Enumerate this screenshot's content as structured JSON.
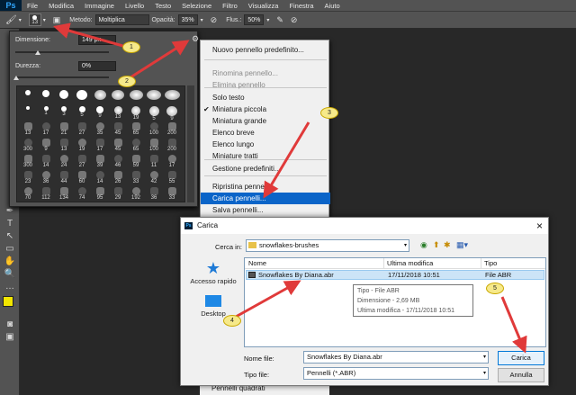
{
  "menubar": {
    "logo": "Ps",
    "items": [
      "File",
      "Modifica",
      "Immagine",
      "Livello",
      "Testo",
      "Selezione",
      "Filtro",
      "Visualizza",
      "Finestra",
      "Aiuto"
    ]
  },
  "options": {
    "brush_size": "13",
    "mode_label": "Metodo:",
    "mode_value": "Moltiplica",
    "opacity_label": "Opacità:",
    "opacity_value": "35%",
    "flow_label": "Flus.:",
    "flow_value": "50%"
  },
  "brush_panel": {
    "size_label": "Dimensione:",
    "size_value": "149 px",
    "hardness_label": "Durezza:",
    "hardness_value": "0%",
    "brush_numbers": [
      "",
      "",
      "",
      "",
      "",
      "",
      "",
      "",
      "",
      "",
      "1",
      "3",
      "5",
      "9",
      "13",
      "19",
      "5",
      "9",
      "13",
      "17",
      "21",
      "27",
      "35",
      "45",
      "65",
      "100",
      "200",
      "300",
      "9",
      "13",
      "19",
      "17",
      "45",
      "65",
      "100",
      "200",
      "300",
      "14",
      "24",
      "27",
      "39",
      "46",
      "59",
      "11",
      "17",
      "23",
      "36",
      "44",
      "60",
      "14",
      "26",
      "33",
      "42",
      "55",
      "70",
      "112",
      "134",
      "74",
      "95",
      "29",
      "192",
      "36",
      "33",
      "63",
      "66"
    ]
  },
  "context_menu": {
    "items": [
      {
        "label": "Nuovo pennello predefinito...",
        "state": "normal"
      },
      {
        "label": "Rinomina pennello...",
        "state": "disabled"
      },
      {
        "label": "Elimina pennello",
        "state": "disabled"
      },
      {
        "label": "Solo testo",
        "state": "normal"
      },
      {
        "label": "Miniatura piccola",
        "state": "checked"
      },
      {
        "label": "Miniatura grande",
        "state": "normal"
      },
      {
        "label": "Elenco breve",
        "state": "normal"
      },
      {
        "label": "Elenco lungo",
        "state": "normal"
      },
      {
        "label": "Miniature tratti",
        "state": "normal"
      },
      {
        "label": "Gestione predefiniti...",
        "state": "normal"
      },
      {
        "label": "Ripristina pennelli...",
        "state": "normal"
      },
      {
        "label": "Carica pennelli...",
        "state": "selected"
      },
      {
        "label": "Salva pennelli...",
        "state": "normal"
      }
    ],
    "bottom_item": "Pennelli quadrati",
    "check_mark": "✔"
  },
  "dialog": {
    "title": "Carica",
    "look_in_label": "Cerca in:",
    "look_in_value": "snowflakes-brushes",
    "sidebar": [
      {
        "label": "Accesso rapido"
      },
      {
        "label": "Desktop"
      }
    ],
    "columns": [
      "Nome",
      "Ultima modifica",
      "Tipo"
    ],
    "rows": [
      {
        "name": "Snowflakes By Diana.abr",
        "modified": "17/11/2018 10:51",
        "type": "File ABR"
      }
    ],
    "tooltip": [
      "Tipo - File ABR",
      "Dimensione - 2,69 MB",
      "Ultima modifica - 17/11/2018 10:51"
    ],
    "filename_label": "Nome file:",
    "filename_value": "Snowflakes By Diana.abr",
    "filetype_label": "Tipo file:",
    "filetype_value": "Pennelli (*.ABR)",
    "load_button": "Carica",
    "cancel_button": "Annulla",
    "close_glyph": "×"
  },
  "callouts": [
    "1",
    "2",
    "3",
    "4",
    "5"
  ],
  "colors": {
    "accent": "#0a64c8",
    "arrow": "#e03a3a",
    "balloon": "#f6e98a",
    "foreground": "#f2e600"
  }
}
